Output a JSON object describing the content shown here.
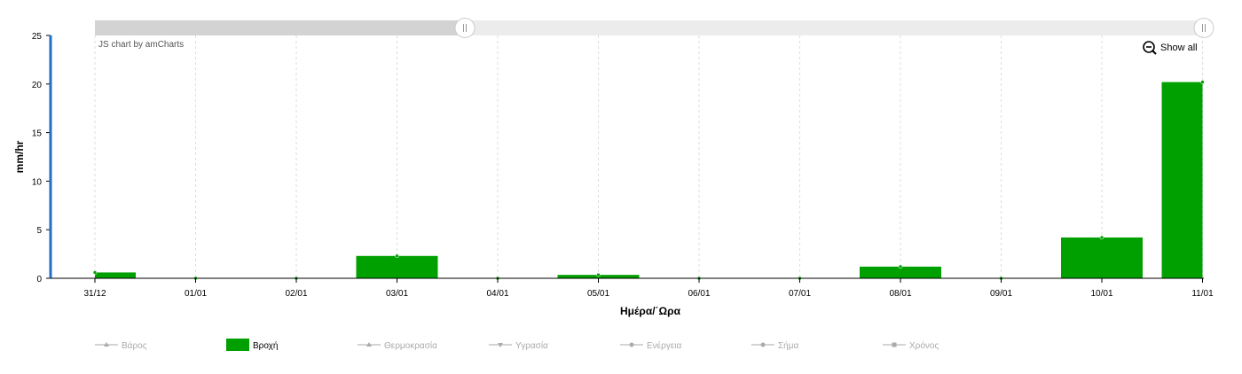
{
  "chart_data": {
    "type": "bar",
    "categories": [
      "31/12",
      "01/01",
      "02/01",
      "03/01",
      "04/01",
      "05/01",
      "06/01",
      "07/01",
      "08/01",
      "09/01",
      "10/01",
      "11/01"
    ],
    "series": [
      {
        "name": "Βροχή",
        "color": "#00a000",
        "values": [
          0.6,
          0,
          0,
          2.3,
          0,
          0.35,
          0,
          0,
          1.2,
          0,
          4.2,
          20.2
        ]
      }
    ],
    "ylabel": "mm/hr",
    "xlabel": "Ημέρα/΄Ωρα",
    "ylim": [
      0,
      25
    ],
    "yticks": [
      0,
      5,
      10,
      15,
      20,
      25
    ],
    "grid": "vertical",
    "legend_position": "bottom",
    "scrollbar": true
  },
  "credit_text": "JS chart by amCharts",
  "show_all_label": "Show all",
  "legend": [
    {
      "label": "Βάρος",
      "active": false,
      "marker": "line-triangle"
    },
    {
      "label": "Βροχή",
      "active": true,
      "marker": "box"
    },
    {
      "label": "Θερμοκρασία",
      "active": false,
      "marker": "line-triangle"
    },
    {
      "label": "Υγρασία",
      "active": false,
      "marker": "line-triangle-down"
    },
    {
      "label": "Ενέργεια",
      "active": false,
      "marker": "line-circle"
    },
    {
      "label": "Σήμα",
      "active": false,
      "marker": "line-circle"
    },
    {
      "label": "Χρόνος",
      "active": false,
      "marker": "line-square"
    }
  ],
  "colors": {
    "accent": "#1f6fc5",
    "bar": "#00a000",
    "legend_inactive": "#aaaaaa",
    "grid": "#dddddd"
  }
}
